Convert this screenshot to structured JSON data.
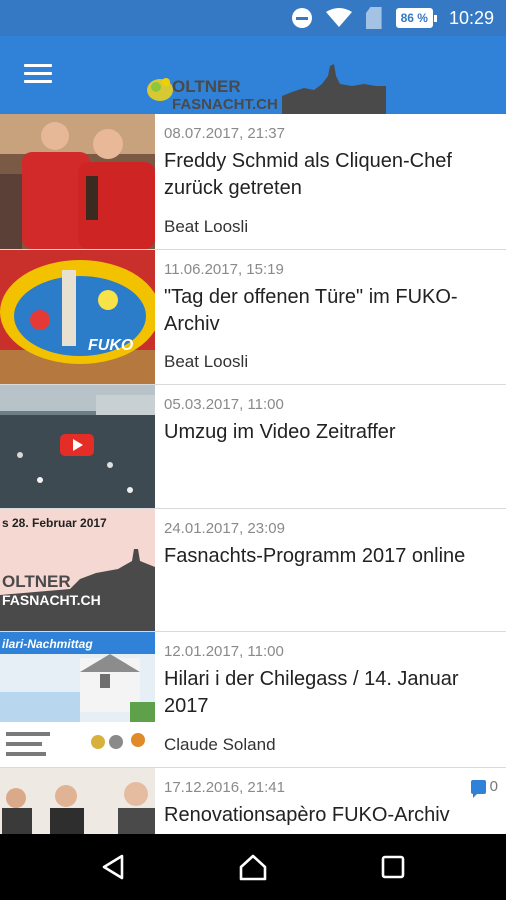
{
  "status_bar": {
    "battery": "86 %",
    "time": "10:29"
  },
  "app_bar": {
    "logo_line1": "OLTNER",
    "logo_line2": "FASNACHT.CH"
  },
  "articles": [
    {
      "date": "08.07.2017, 21:37",
      "title": "Freddy Schmid als Cliquen-Chef zurück getreten",
      "author": "Beat Loosli"
    },
    {
      "date": "11.06.2017, 15:19",
      "title": "\"Tag der offenen Türe\" im FUKO-Archiv",
      "author": "Beat Loosli",
      "thumb_text": "FUKO"
    },
    {
      "date": "05.03.2017, 11:00",
      "title": "Umzug im Video Zeitraffer",
      "author": ""
    },
    {
      "date": "24.01.2017, 23:09",
      "title": "Fasnachts-Programm 2017 online",
      "author": "",
      "thumb_top": "s 28. Februar 2017",
      "thumb_l1": "OLTNER",
      "thumb_l2": "FASNACHT.CH"
    },
    {
      "date": "12.01.2017, 11:00",
      "title": "Hilari i der Chilegass / 14. Januar 2017",
      "author": "Claude Soland",
      "thumb_top": "ilari-Nachmittag"
    },
    {
      "date": "17.12.2016, 21:41",
      "title": "Renovationsapèro FUKO-Archiv",
      "author": "",
      "comments": "0"
    }
  ],
  "colors": {
    "status_bar": "#3579c4",
    "app_bar": "#2f82d8",
    "accent": "#2f82d8"
  },
  "icons": [
    "do-not-disturb-icon",
    "wifi-icon",
    "sim-icon",
    "battery-icon",
    "menu-icon",
    "comment-icon",
    "back-icon",
    "home-icon",
    "recents-icon"
  ]
}
